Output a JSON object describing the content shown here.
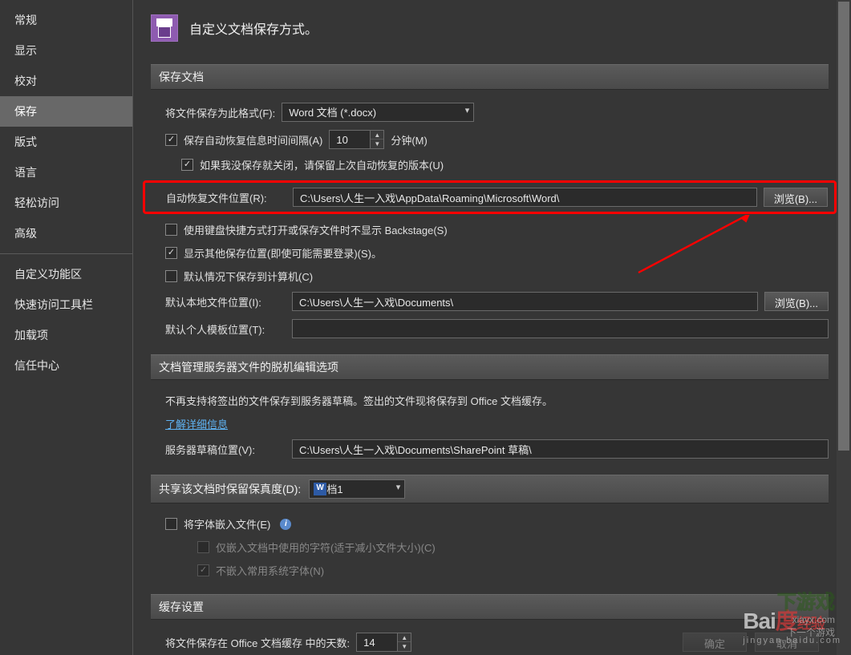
{
  "sidebar": {
    "items": [
      {
        "label": "常规"
      },
      {
        "label": "显示"
      },
      {
        "label": "校对"
      },
      {
        "label": "保存",
        "selected": true
      },
      {
        "label": "版式"
      },
      {
        "label": "语言"
      },
      {
        "label": "轻松访问"
      },
      {
        "label": "高级"
      }
    ],
    "items2": [
      {
        "label": "自定义功能区"
      },
      {
        "label": "快速访问工具栏"
      },
      {
        "label": "加载项"
      },
      {
        "label": "信任中心"
      }
    ]
  },
  "header": {
    "title": "自定义文档保存方式。"
  },
  "sections": {
    "save_docs": "保存文档",
    "offline": "文档管理服务器文件的脱机编辑选项",
    "share": "共享该文档时保留保真度(D):",
    "cache": "缓存设置"
  },
  "save": {
    "format_label": "将文件保存为此格式(F):",
    "format_value": "Word 文档 (*.docx)",
    "autosave_label": "保存自动恢复信息时间间隔(A)",
    "autosave_interval": "10",
    "minutes_label": "分钟(M)",
    "keep_last_label": "如果我没保存就关闭，请保留上次自动恢复的版本(U)",
    "autorecover_loc_label": "自动恢复文件位置(R):",
    "autorecover_path": "C:\\Users\\人生一入戏\\AppData\\Roaming\\Microsoft\\Word\\",
    "browse1": "浏览(B)...",
    "backstage_label": "使用键盘快捷方式打开或保存文件时不显示 Backstage(S)",
    "show_other_label": "显示其他保存位置(即使可能需要登录)(S)。",
    "save_local_label": "默认情况下保存到计算机(C)",
    "default_loc_label": "默认本地文件位置(I):",
    "default_path": "C:\\Users\\人生一入戏\\Documents\\",
    "browse2": "浏览(B)...",
    "template_loc_label": "默认个人模板位置(T):",
    "template_path": ""
  },
  "offline": {
    "info_text": "不再支持将签出的文件保存到服务器草稿。签出的文件现将保存到 Office 文档缓存。",
    "link_text": "了解详细信息",
    "draft_loc_label": "服务器草稿位置(V):",
    "draft_path": "C:\\Users\\人生一入戏\\Documents\\SharePoint 草稿\\"
  },
  "share": {
    "doc_value": "文档1",
    "embed_fonts_label": "将字体嵌入文件(E)",
    "embed_used_label": "仅嵌入文档中使用的字符(适于减小文件大小)(C)",
    "no_system_fonts_label": "不嵌入常用系统字体(N)"
  },
  "cache": {
    "days_label": "将文件保存在 Office 文档缓存 中的天数:",
    "days_value": "14"
  },
  "buttons": {
    "ok": "确定",
    "cancel": "取消"
  },
  "watermark": {
    "brand": "Baidu",
    "tag": "经验",
    "sub": "jingyan.baidu.com",
    "game1": "下游戏",
    "game2": "xiayx.com",
    "game3": "下一个游戏"
  }
}
